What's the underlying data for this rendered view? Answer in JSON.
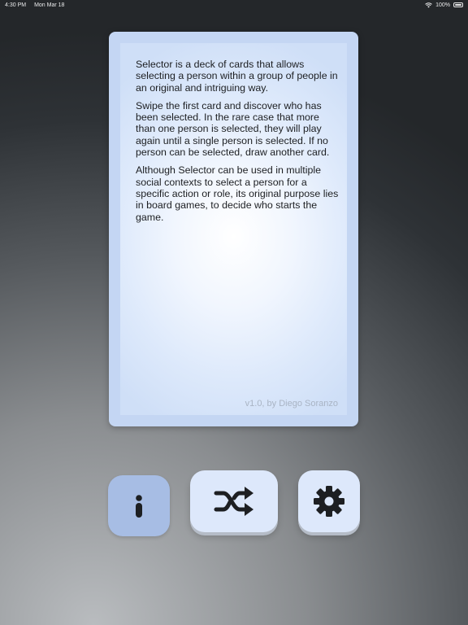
{
  "status_bar": {
    "time": "4:30 PM",
    "date": "Mon Mar 18",
    "battery": "100%"
  },
  "card": {
    "paragraphs": [
      "Selector is a deck of cards that allows selecting a person within a group of people in an original and intriguing way.",
      "Swipe the first card and discover who has been selected. In the rare case that more than one person is selected, they will play again until a single person is selected. If no person can be selected, draw another card.",
      "Although Selector can be used in multiple social contexts to select a person for a specific action or role, its original purpose lies in board games, to decide who starts the game."
    ],
    "version": "v1.0, by Diego Soranzo"
  },
  "buttons": {
    "info_icon": "info-icon",
    "shuffle_icon": "shuffle-icon",
    "settings_icon": "gear-icon"
  },
  "colors": {
    "card_border": "#c4d6f3",
    "button_active": "#a7bde4",
    "button_default": "#dde8fb",
    "icon": "#1d1f22"
  }
}
